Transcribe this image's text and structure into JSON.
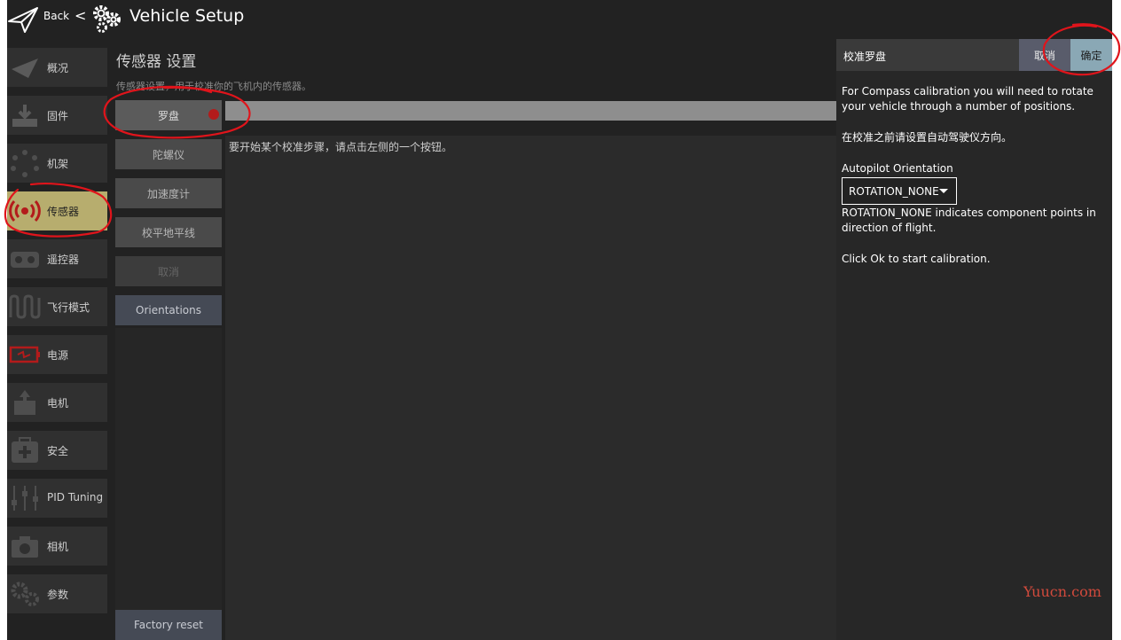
{
  "toolbar": {
    "back_label": "Back",
    "separator": "<",
    "title": "Vehicle Setup"
  },
  "sidebar": {
    "items": [
      {
        "label": "概况",
        "icon": "paper-plane-icon"
      },
      {
        "label": "固件",
        "icon": "download-firmware-icon"
      },
      {
        "label": "机架",
        "icon": "airframe-dots-icon"
      },
      {
        "label": "传感器",
        "icon": "sensor-radio-icon",
        "active": true
      },
      {
        "label": "遥控器",
        "icon": "radio-controller-icon"
      },
      {
        "label": "飞行模式",
        "icon": "flight-mode-wave-icon"
      },
      {
        "label": "电源",
        "icon": "battery-icon"
      },
      {
        "label": "电机",
        "icon": "motor-icon"
      },
      {
        "label": "安全",
        "icon": "first-aid-icon"
      },
      {
        "label": "PID Tuning",
        "icon": "sliders-icon"
      },
      {
        "label": "相机",
        "icon": "camera-icon"
      },
      {
        "label": "参数",
        "icon": "gears-icon"
      }
    ]
  },
  "sensors": {
    "title": "传感器 设置",
    "description": "传感器设置，用于校准你的飞机内的传感器。",
    "buttons": {
      "compass": "罗盘",
      "gyro": "陀螺仪",
      "accel": "加速度计",
      "level": "校平地平线",
      "cancel": "取消",
      "orientations": "Orientations",
      "factory_reset": "Factory reset"
    },
    "instruction": "要开始某个校准步骤，请点击左侧的一个按钮。"
  },
  "panel": {
    "title": "校准罗盘",
    "cancel_label": "取消",
    "ok_label": "确定",
    "text1": "For Compass calibration you will need to rotate your vehicle through a number of positions.",
    "text2": "在校准之前请设置自动驾驶仪方向。",
    "orientation_label": "Autopilot Orientation",
    "orientation_value": "ROTATION_NONE",
    "orientation_note": "ROTATION_NONE indicates component points in direction of flight.",
    "start_note": "Click Ok to start calibration."
  },
  "colors": {
    "active_item": "#b7ad6e",
    "status_dot": "#b31b1b",
    "ok_button": "#8aa8b5",
    "annotation": "#e0141b"
  },
  "watermark": "Yuucn.com"
}
